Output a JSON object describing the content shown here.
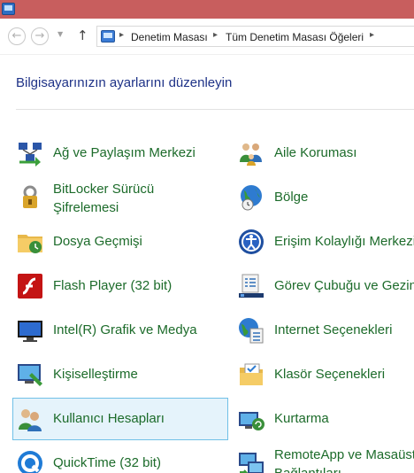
{
  "addressbar": {
    "crumbs": [
      "Denetim Masası",
      "Tüm Denetim Masası Öğeleri"
    ]
  },
  "heading": "Bilgisayarınızın ayarlarını düzenleyin",
  "items_left": [
    {
      "label": "Ağ ve Paylaşım Merkezi",
      "icon": "network-center-icon"
    },
    {
      "label": "BitLocker Sürücü Şifrelemesi",
      "label_line1": "BitLocker Sürücü",
      "label_line2": "Şifrelemesi",
      "icon": "bitlocker-icon"
    },
    {
      "label": "Dosya Geçmişi",
      "icon": "file-history-icon"
    },
    {
      "label": "Flash Player (32 bit)",
      "icon": "flash-player-icon"
    },
    {
      "label": "Intel(R) Grafik ve Medya",
      "icon": "intel-graphics-icon"
    },
    {
      "label": "Kişiselleştirme",
      "icon": "personalization-icon"
    },
    {
      "label": "Kullanıcı Hesapları",
      "icon": "user-accounts-icon"
    },
    {
      "label": "QuickTime (32 bit)",
      "icon": "quicktime-icon"
    }
  ],
  "items_right": [
    {
      "label": "Aile Koruması",
      "icon": "family-safety-icon"
    },
    {
      "label": "Bölge",
      "icon": "region-icon"
    },
    {
      "label": "Erişim Kolaylığı Merkezi",
      "icon": "ease-of-access-icon"
    },
    {
      "label": "Görev Çubuğu ve Gezinti",
      "icon": "taskbar-icon"
    },
    {
      "label": "Internet Seçenekleri",
      "icon": "internet-options-icon"
    },
    {
      "label": "Klasör Seçenekleri",
      "icon": "folder-options-icon"
    },
    {
      "label": "Kurtarma",
      "icon": "recovery-icon"
    },
    {
      "label": "RemoteApp ve Masaüstü Bağlantıları",
      "label_line1": "RemoteApp ve Masaüstü",
      "label_line2": "Bağlantıları",
      "icon": "remoteapp-icon"
    }
  ],
  "selected_item": "Kullanıcı Hesapları",
  "colors": {
    "title_bar": "#c85e5e",
    "heading": "#1e3287",
    "item_text": "#1c6b2a",
    "selection_bg": "#e5f3fb",
    "selection_border": "#70c0e7"
  }
}
